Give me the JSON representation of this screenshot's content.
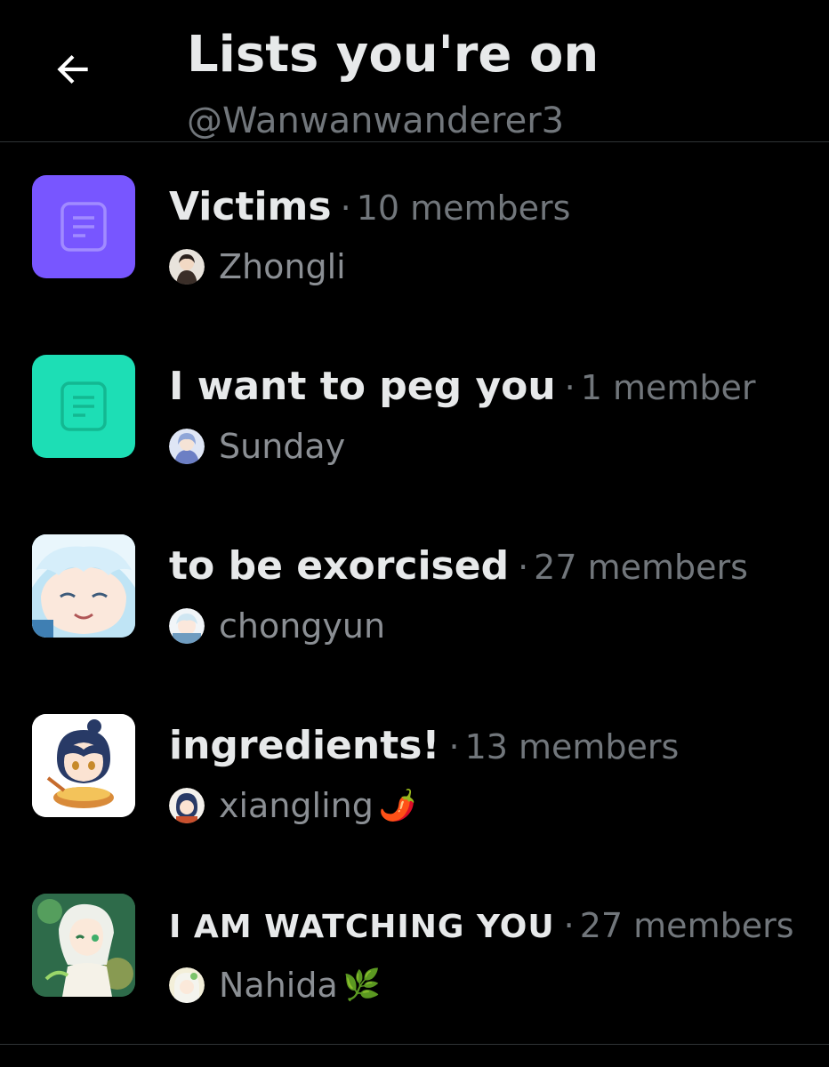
{
  "header": {
    "title": "Lists you're on",
    "handle": "@Wanwanwanderer3",
    "back_icon": "arrow-left-icon"
  },
  "colors": {
    "background": "#000000",
    "primary_text": "#e7e9ea",
    "secondary_text": "#71767b",
    "divider": "#2f3336"
  },
  "lists": [
    {
      "name": "Victims",
      "dot": "·",
      "members": "10 members",
      "owner": "Zhongli",
      "owner_emoji": "",
      "thumb": "default-list-icon",
      "thumb_color": "#7856ff"
    },
    {
      "name": "I want to peg you",
      "dot": "·",
      "members": "1 member",
      "owner": "Sunday",
      "owner_emoji": "",
      "thumb": "default-list-icon",
      "thumb_color": "#1ddeb5"
    },
    {
      "name": "to be exorcised",
      "dot": "·",
      "members": "27 members",
      "owner": "chongyun",
      "owner_emoji": "",
      "thumb": "chibi-portrait-image",
      "thumb_color": "#9fd3ee"
    },
    {
      "name": "ingredients!",
      "dot": "·",
      "members": "13 members",
      "owner": "xiangling",
      "owner_emoji": "🌶️",
      "thumb": "chibi-portrait-image",
      "thumb_color": "#ffffff"
    },
    {
      "name": "I AM WATCHING YOU",
      "dot": "·",
      "members": "27 members",
      "owner": "Nahida",
      "owner_emoji": "🌿",
      "thumb": "portrait-image",
      "thumb_color": "#2f6b48"
    }
  ]
}
